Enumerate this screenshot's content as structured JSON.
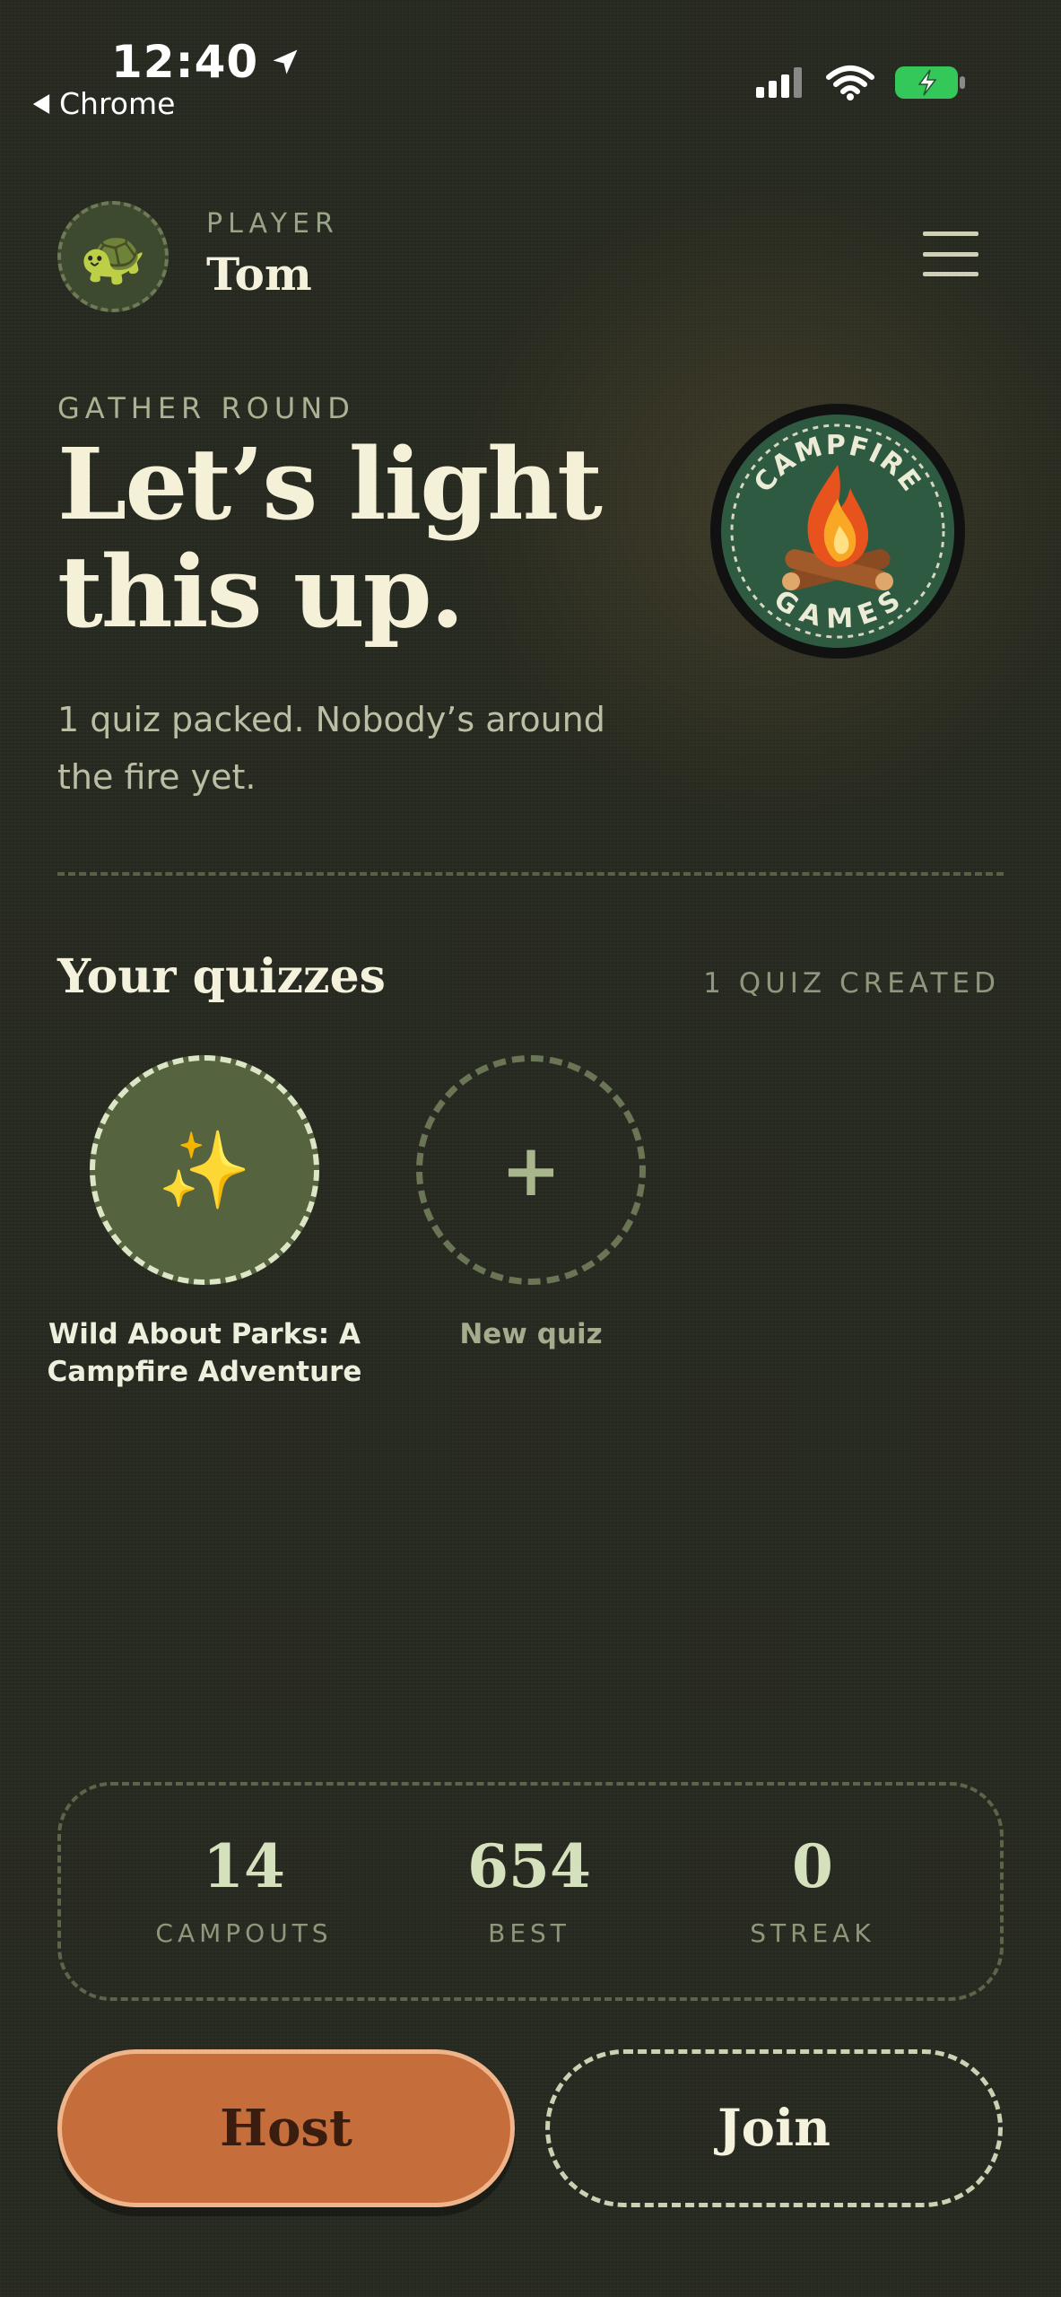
{
  "status_bar": {
    "time": "12:40",
    "back_app": "Chrome",
    "icons": [
      "location-arrow-icon",
      "cellular-signal-icon",
      "wifi-icon",
      "battery-charging-icon"
    ]
  },
  "header": {
    "avatar_emoji": "🐢",
    "kicker": "PLAYER",
    "player_name": "Tom",
    "menu_icon": "hamburger-menu-icon"
  },
  "hero": {
    "kicker": "GATHER ROUND",
    "title": "Let’s light this up.",
    "subtitle": "1 quiz packed. Nobody’s around the fire yet."
  },
  "badge": {
    "top_text": "CAMPFIRE",
    "bottom_text": "GAMES"
  },
  "quizzes": {
    "title": "Your quizzes",
    "count_label": "1 QUIZ CREATED",
    "items": [
      {
        "icon": "✨",
        "label": "Wild About Parks: A Campfire Adventure"
      }
    ],
    "new_quiz": {
      "icon": "+",
      "label": "New quiz"
    }
  },
  "stats": [
    {
      "value": "14",
      "label": "CAMPOUTS"
    },
    {
      "value": "654",
      "label": "BEST"
    },
    {
      "value": "0",
      "label": "STREAK"
    }
  ],
  "actions": {
    "host_label": "Host",
    "join_label": "Join"
  },
  "colors": {
    "background": "#26291f",
    "accent_host": "#c66e3b",
    "stat_value": "#d5e0bc",
    "quiz_filled": "#56633f"
  }
}
